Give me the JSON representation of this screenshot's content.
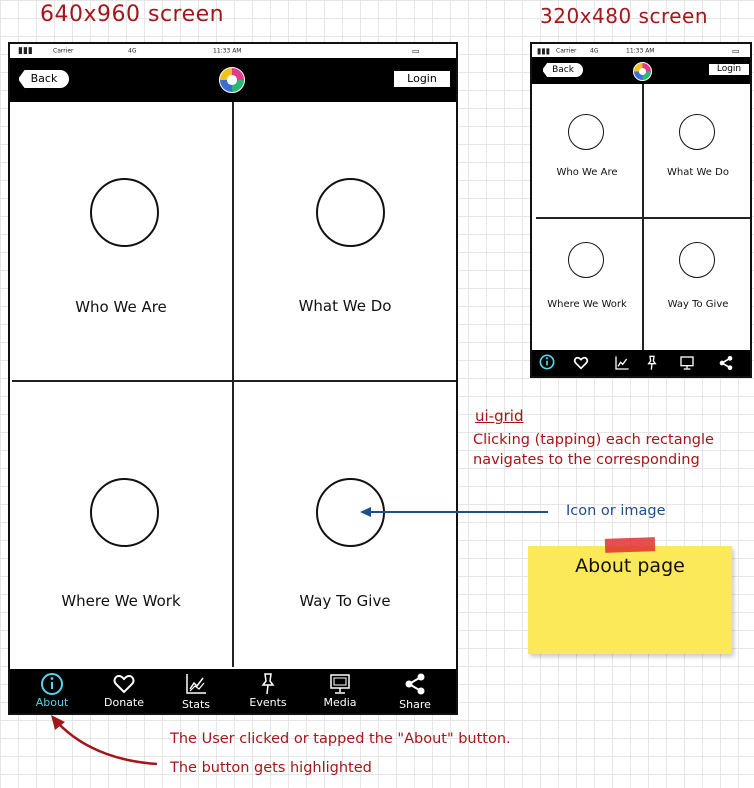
{
  "headings": {
    "large": "640x960 screen",
    "small": "320x480 screen"
  },
  "status_bar": {
    "carrier": "Carrier",
    "network": "4G",
    "time": "11:33 AM"
  },
  "nav": {
    "back_label": "Back",
    "login_label": "Login"
  },
  "grid": {
    "items": [
      {
        "label": "Who We Are"
      },
      {
        "label": "What We Do"
      },
      {
        "label": "Where We Work"
      },
      {
        "label": "Way To Give"
      }
    ]
  },
  "tabs": [
    {
      "label": "About",
      "icon": "info-icon",
      "active": true
    },
    {
      "label": "Donate",
      "icon": "heart-icon",
      "active": false
    },
    {
      "label": "Stats",
      "icon": "chart-icon",
      "active": false
    },
    {
      "label": "Events",
      "icon": "pushpin-icon",
      "active": false
    },
    {
      "label": "Media",
      "icon": "monitor-icon",
      "active": false
    },
    {
      "label": "Share",
      "icon": "share-icon",
      "active": false
    }
  ],
  "annotations": {
    "ui_grid_title": "ui-grid",
    "ui_grid_line1": "Clicking (tapping) each rectangle",
    "ui_grid_line2": "navigates to the corresponding",
    "icon_note": "Icon or image",
    "sticky_note": "About page",
    "click_note": "The User clicked or tapped the \"About\" button.",
    "highlight_note": "The button gets highlighted"
  },
  "colors": {
    "annotation_red": "#a3161b",
    "annotation_blue": "#1f4e8c",
    "active_tab": "#56d6e8",
    "sticky_yellow": "#fbe95a",
    "tape_red": "#e03030"
  }
}
